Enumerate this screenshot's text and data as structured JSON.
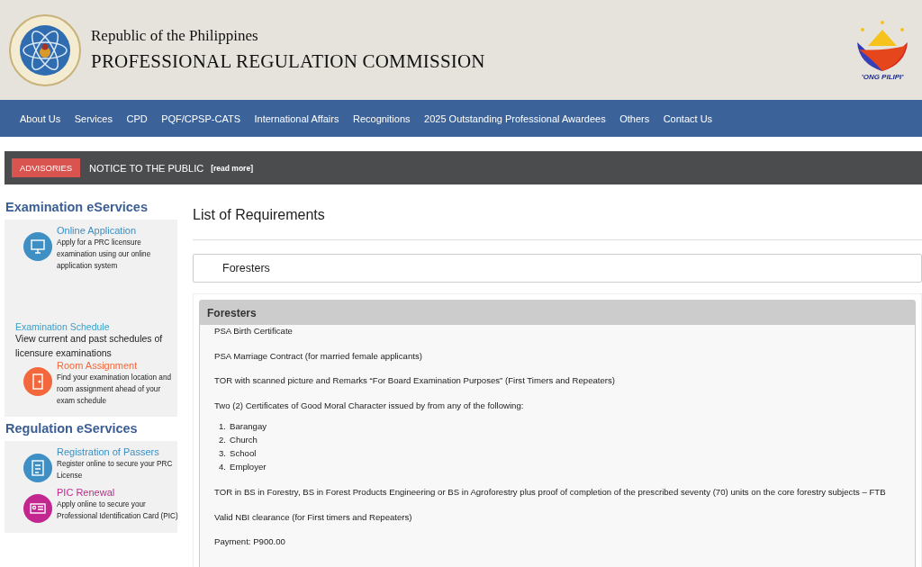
{
  "header": {
    "subtitle": "Republic of the Philippines",
    "title": "PROFESSIONAL REGULATION COMMISSION",
    "logo_caption": "ʼONG PILIPIʼ"
  },
  "nav": [
    "About Us",
    "Services",
    "CPD",
    "PQF/CPSP-CATS",
    "International Affairs",
    "Recognitions",
    "2025 Outstanding Professional Awardees",
    "Others",
    "Contact Us"
  ],
  "advisory": {
    "badge": "ADVISORIES",
    "notice": "NOTICE TO THE PUBLIC",
    "link": "[read more]"
  },
  "sidebar": [
    {
      "heading": "Examination eServices",
      "items": [
        {
          "kind": "computer",
          "color": "#3d8fc4",
          "title": "Online Application",
          "text": "Apply for a PRC licensure examination using our online application system"
        },
        {
          "kind": "plain",
          "title": "Examination Schedule",
          "text": "View current and past schedules of licensure examinations"
        },
        {
          "kind": "door",
          "color": "#f2683c",
          "title": "Room Assignment",
          "text": "Find your examination location and room assignment ahead of your exam schedule"
        }
      ]
    },
    {
      "heading": "Regulation eServices",
      "items": [
        {
          "kind": "clipboard",
          "color": "#3d8fc4",
          "title": "Registration of Passers",
          "text": "Register online to secure your PRC License"
        },
        {
          "kind": "idcard",
          "color": "#c4268f",
          "title": "PIC Renewal",
          "text": "Apply online to secure your Professional Identification Card (PIC)"
        }
      ]
    }
  ],
  "main": {
    "heading": "List of Requirements",
    "search": {
      "value": "Foresters"
    },
    "panel": {
      "title": "Foresters",
      "items": [
        {
          "kind": "paragraph",
          "text": "PSA Birth Certificate"
        },
        {
          "kind": "paragraph",
          "text": "PSA Marriage Contract (for married female applicants)"
        },
        {
          "kind": "paragraph",
          "text": "TOR with scanned picture and Remarks “For Board Examination Purposes” (First Timers and Repeaters)"
        },
        {
          "kind": "paragraph",
          "text": "Two (2) Certificates of Good Moral Character issued by from any of the following:"
        },
        {
          "kind": "list",
          "entries": [
            {
              "number": "1.",
              "text": "Barangay"
            },
            {
              "number": "2.",
              "text": "Church"
            },
            {
              "number": "3.",
              "text": "School"
            },
            {
              "number": "4.",
              "text": "Employer"
            }
          ]
        },
        {
          "kind": "paragraph",
          "text": "TOR in BS in Forestry, BS in Forest Products Engineering or BS in Agroforestry plus proof of completion of the prescribed seventy (70) units on the core forestry subjects – FTB"
        },
        {
          "kind": "paragraph",
          "text": "Valid NBI clearance (for First timers and Repeaters)"
        },
        {
          "kind": "paragraph",
          "text": "Payment: P900.00"
        }
      ]
    }
  }
}
